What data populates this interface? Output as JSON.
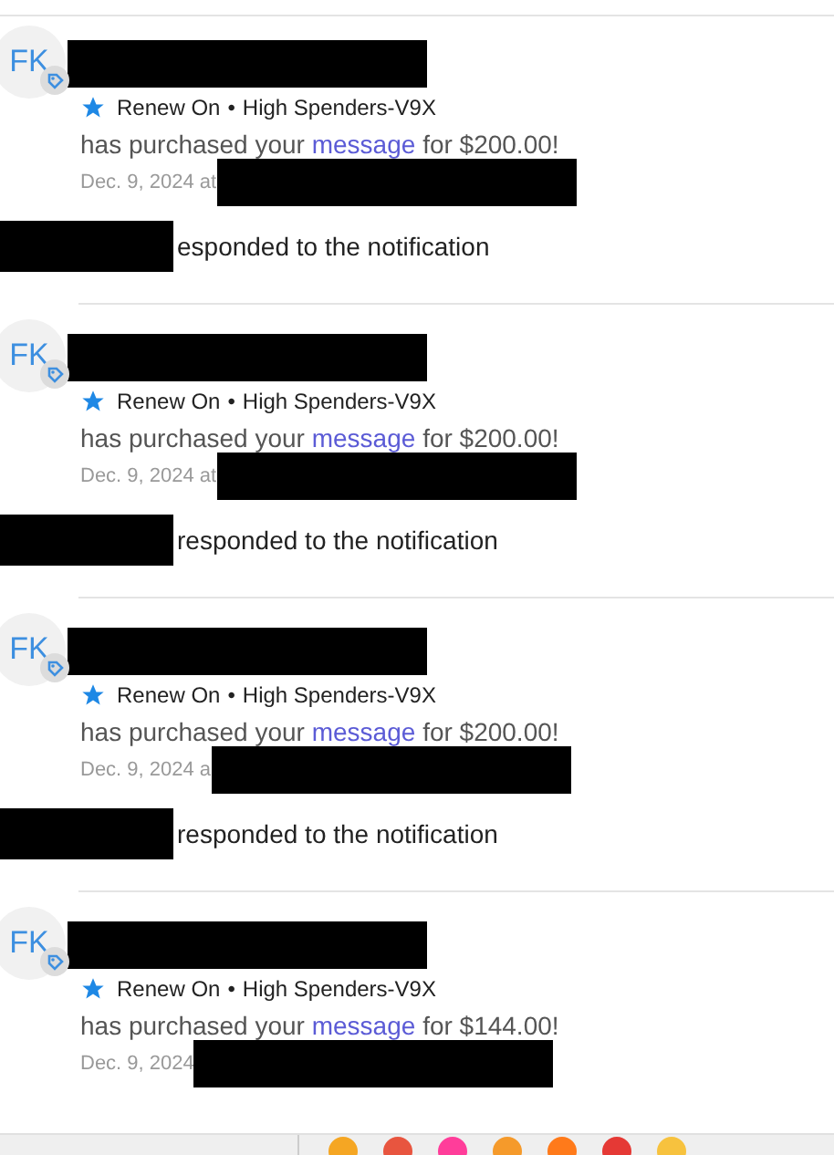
{
  "notifications": [
    {
      "avatar": "FK",
      "meta": "Renew On",
      "separator": "•",
      "tier": "High Spenders-V9X",
      "purchase_before": "has purchased your",
      "purchase_link": "message",
      "purchase_after": "for $200.00!",
      "date": "Dec. 9, 2024 at",
      "response": "esponded to the notification"
    },
    {
      "avatar": "FK",
      "meta": "Renew On",
      "separator": "•",
      "tier": "High Spenders-V9X",
      "purchase_before": "has purchased your",
      "purchase_link": "message",
      "purchase_after": "for $200.00!",
      "date": "Dec. 9, 2024 at",
      "response": "responded to the notification"
    },
    {
      "avatar": "FK",
      "meta": "Renew On",
      "separator": "•",
      "tier": "High Spenders-V9X",
      "purchase_before": "has purchased your",
      "purchase_link": "message",
      "purchase_after": "for $200.00!",
      "date": "Dec. 9, 2024 a",
      "response": "responded to the notification"
    },
    {
      "avatar": "FK",
      "meta": "Renew On",
      "separator": "•",
      "tier": "High Spenders-V9X",
      "purchase_before": "has purchased your",
      "purchase_link": "message",
      "purchase_after": "for $144.00!",
      "date": "Dec. 9, 2024"
    }
  ]
}
